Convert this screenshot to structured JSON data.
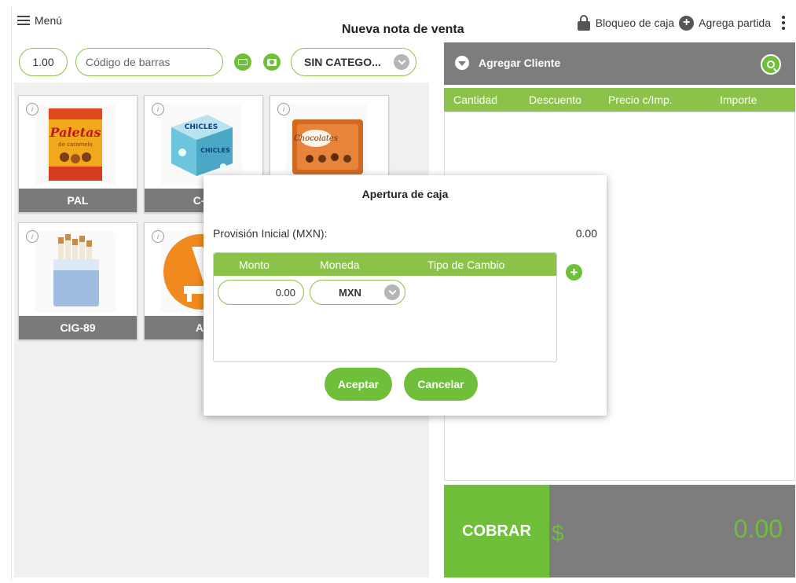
{
  "header": {
    "menu_label": "Menú",
    "title": "Nueva nota de venta",
    "lock_label": "Bloqueo de caja",
    "add_item_label": "Agrega partida"
  },
  "search": {
    "quantity": "1.00",
    "barcode_placeholder": "Código de barras",
    "category_selected": "SIN CATEGO..."
  },
  "products": [
    {
      "code": "PAL",
      "image": "paletas-de-caramelo"
    },
    {
      "code": "C-M",
      "image": "chicles-box"
    },
    {
      "code": "",
      "image": "chocolate-box"
    },
    {
      "code": "CIG-89",
      "image": "cigarette-pack"
    },
    {
      "code": "AR",
      "image": "orange-tool-icon"
    }
  ],
  "cart": {
    "add_customer": "Agregar Cliente",
    "columns": [
      "Cantidad",
      "Descuento",
      "Precio c/Imp.",
      "Importe"
    ],
    "charge_label": "COBRAR",
    "currency_symbol": "$",
    "total": "0.00"
  },
  "modal": {
    "title": "Apertura de caja",
    "provision_label": "Provisión Inicial (MXN):",
    "provision_value": "0.00",
    "columns": [
      "Monto",
      "Moneda",
      "Tipo de Cambio"
    ],
    "amount_value": "0.00",
    "currency_value": "MXN",
    "accept_label": "Aceptar",
    "cancel_label": "Cancelar"
  },
  "colors": {
    "accent_green": "#6fbf3b",
    "header_green": "#8bc34a",
    "panel_gray": "#7d7d7d"
  }
}
